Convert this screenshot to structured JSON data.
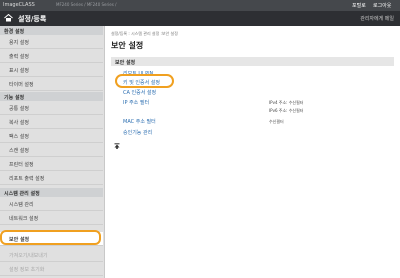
{
  "topbar": {
    "brand": "ImageCLASS",
    "device_name": "MF240 Series / MF240 Series /",
    "portal_link": "포털로",
    "logout_link": "로그아웃"
  },
  "titlebar": {
    "title": "설정/등록",
    "mail_link": "관리자에게 메일",
    "home_icon": "home-icon"
  },
  "sidebar": {
    "sections": [
      {
        "heading": "환경 설정",
        "items": [
          "용지 설정",
          "출력 설정",
          "표시 설정",
          "타이머 설정"
        ]
      },
      {
        "heading": "기능 설정",
        "items": [
          "공통 설정",
          "복사 설정",
          "팩스 설정",
          "스캔 설정",
          "프린터 설정",
          "리포트 출력 설정"
        ]
      },
      {
        "heading": "시스템 관리 설정",
        "items": [
          "시스템 관리",
          "네트워크 설정",
          "보안 설정",
          "가져오기/내보내기",
          "설정 정보 초기화"
        ]
      }
    ],
    "active_item": "보안 설정"
  },
  "content": {
    "breadcrumb": "설정/등록 : 시스템 관리 설정 :보안 설정",
    "page_title": "보안 설정",
    "panel_heading": "보안 설정",
    "links": {
      "remote_ui_pin": "리모트 UI PIN",
      "key_cert": "키 및 인증서 설정",
      "ca_cert": "CA 인증서 설정",
      "ip_filter": "IP 주소 필터",
      "mac_filter": "MAC 주소 필터",
      "auth_mgmt": "승인기능 관리"
    },
    "values": {
      "ipv4_filter": "IPv4 주소: 수신필터",
      "ipv6_filter": "IPv6 주소: 수신필터",
      "mac_filter": "수신필터"
    },
    "top_icon": "arrow-up-icon"
  },
  "accent_color": "#f0a020"
}
